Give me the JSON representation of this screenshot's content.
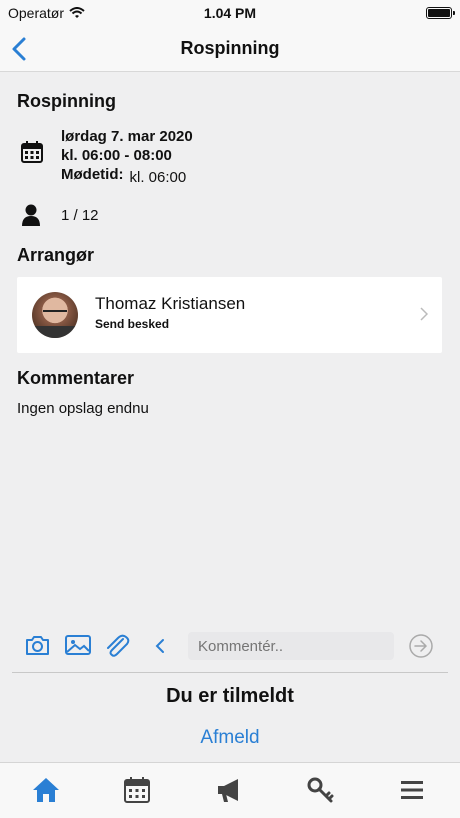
{
  "status_bar": {
    "carrier": "Operatør",
    "time": "1.04 PM"
  },
  "nav": {
    "title": "Rospinning",
    "back_icon": "chevron-left-icon"
  },
  "event": {
    "title": "Rospinning",
    "date": "lørdag 7. mar 2020",
    "time_range": "kl. 06:00 - 08:00",
    "meet_label": "Mødetid:",
    "meet_time": "kl. 06:00",
    "participants": "1 / 12"
  },
  "organizer": {
    "heading": "Arrangør",
    "name": "Thomaz Kristiansen",
    "action": "Send besked"
  },
  "comments": {
    "heading": "Kommentarer",
    "empty_text": "Ingen opslag endnu",
    "placeholder": "Kommentér.."
  },
  "signup": {
    "status": "Du er tilmeldt",
    "action": "Afmeld"
  },
  "tabs": [
    "home-icon",
    "calendar-icon",
    "megaphone-icon",
    "key-icon",
    "menu-icon"
  ],
  "colors": {
    "accent": "#2a7fd4",
    "background": "#efeff0"
  }
}
